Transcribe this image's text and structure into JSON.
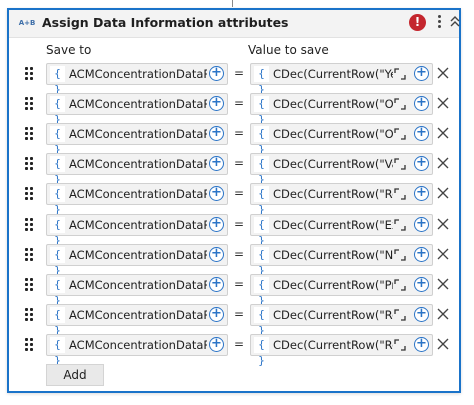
{
  "activity": {
    "icon_text": "A+B",
    "title": "Assign Data Information attributes",
    "error_symbol": "!",
    "colors": {
      "accent": "#1a73c9",
      "error": "#c4262e",
      "icon_blue": "#2b74c7"
    }
  },
  "columns": {
    "save_to": "Save to",
    "value_to_save": "Value to save"
  },
  "rows": [
    {
      "save_to": "ACMConcentrationDataRe",
      "value": "CDec(CurrentRow(\"Ye"
    },
    {
      "save_to": "ACMConcentrationDataRe",
      "value": "CDec(CurrentRow(\"Ob"
    },
    {
      "save_to": "ACMConcentrationDataRe",
      "value": "CDec(CurrentRow(\"Ob"
    },
    {
      "save_to": "ACMConcentrationDataRe",
      "value": "CDec(CurrentRow(\"Va"
    },
    {
      "save_to": "ACMConcentrationDataRe",
      "value": "CDec(CurrentRow(\"Re"
    },
    {
      "save_to": "ACMConcentrationDataRe",
      "value": "CDec(CurrentRow(\"Ex"
    },
    {
      "save_to": "ACMConcentrationDataRe",
      "value": "CDec(CurrentRow(\"Nu"
    },
    {
      "save_to": "ACMConcentrationDataRe",
      "value": "CDec(CurrentRow(\"Pri"
    },
    {
      "save_to": "ACMConcentrationDataRe",
      "value": "CDec(CurrentRow(\"Re"
    },
    {
      "save_to": "ACMConcentrationDataRe",
      "value": "CDec(CurrentRow(\"Re"
    }
  ],
  "row_symbols": {
    "brace": "{ }",
    "equals": "=",
    "plus": "+"
  },
  "add_button_label": "Add"
}
